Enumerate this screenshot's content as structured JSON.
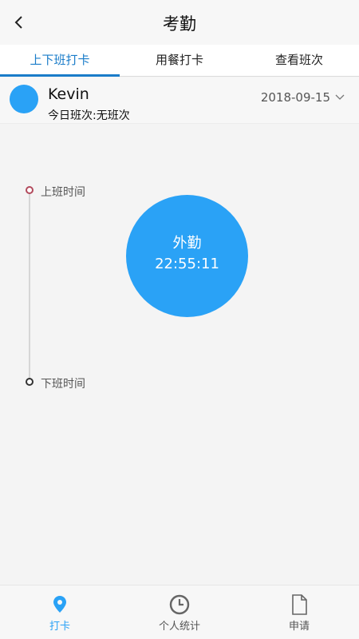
{
  "header": {
    "title": "考勤",
    "back_icon": "chevron-left-icon"
  },
  "tabs": [
    {
      "label": "上下班打卡",
      "active": true
    },
    {
      "label": "用餐打卡",
      "active": false
    },
    {
      "label": "查看班次",
      "active": false
    }
  ],
  "user": {
    "name": "Kevin",
    "shift": "今日班次:无班次",
    "date": "2018-09-15"
  },
  "timeline": {
    "start_label": "上班时间",
    "end_label": "下班时间"
  },
  "punch": {
    "type": "外勤",
    "time": "22:55:11"
  },
  "bottom_nav": [
    {
      "label": "打卡",
      "icon": "location-pin-icon",
      "active": true
    },
    {
      "label": "个人统计",
      "icon": "clock-icon",
      "active": false
    },
    {
      "label": "申请",
      "icon": "document-icon",
      "active": false
    }
  ],
  "colors": {
    "accent": "#2aa2f6",
    "tab_active": "#1a7cc9",
    "timeline_start": "#b24a5c"
  }
}
